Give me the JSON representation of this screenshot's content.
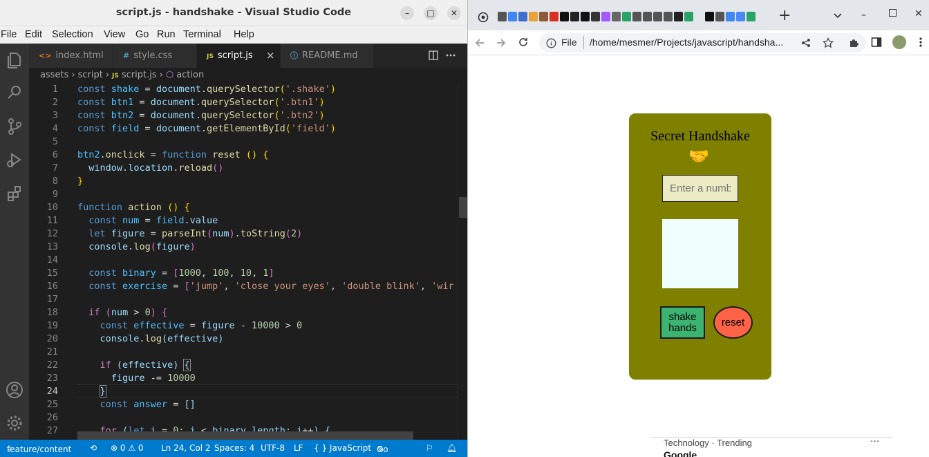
{
  "vscode": {
    "title": "script.js - handshake - Visual Studio Code",
    "window_controls": {
      "minimize": "–",
      "maximize": "□",
      "close": "✕"
    },
    "menu": [
      "File",
      "Edit",
      "Selection",
      "View",
      "Go",
      "Run",
      "Terminal",
      "Help"
    ],
    "tabs": [
      {
        "icon": "<>",
        "label": "index.html"
      },
      {
        "icon": "#",
        "label": "style.css"
      },
      {
        "icon": "JS",
        "label": "script.js"
      },
      {
        "icon": "ⓘ",
        "label": "README.md"
      }
    ],
    "active_tab_close": "×",
    "breadcrumb": {
      "part1": "assets",
      "part2": "script",
      "part3": "script.js",
      "part4": "action"
    },
    "current_line": "24",
    "status": {
      "branch": "feature/content",
      "problems": "⊗ 0 ⚠ 0",
      "position": "Ln 24, Col 2",
      "spaces": "Spaces: 4",
      "encoding": "UTF-8",
      "eol": "LF",
      "language": "{ } JavaScript",
      "golive": "Go Live"
    }
  },
  "code_lines": [
    "const shake = document.querySelector('.shake')",
    "const btn1 = document.querySelector('.btn1')",
    "const btn2 = document.querySelector('.btn2')",
    "const field = document.getElementById('field')",
    "",
    "btn2.onclick = function reset () {",
    "  window.location.reload()",
    "}",
    "",
    "function action () {",
    "  const num = field.value",
    "  let figure = parseInt(num).toString(2)",
    "  console.log(figure)",
    "",
    "  const binary = [1000, 100, 10, 1]",
    "  const exercise = ['jump', 'close your eyes', 'double blink', 'wir",
    "",
    "  if (num > 0) {",
    "    const effective = figure - 10000 > 0",
    "    console.log(effective)",
    "",
    "    if (effective) {",
    "      figure -= 10000",
    "    }",
    "    const answer = []",
    "",
    "    for (let i = 0; i < binary.length; i++) {"
  ],
  "chrome": {
    "new_tab": "+",
    "omnibox_scheme": "File",
    "url": "/home/mesmer/Projects/javascript/handsha...",
    "page": {
      "title": "Secret Handshake",
      "emoji": "🤝",
      "input_placeholder": "Enter a number",
      "shake_button": "shake hands",
      "reset_button": "reset"
    },
    "news_text": "Technology · Trending",
    "news_more": "···",
    "news_next": "Google"
  }
}
